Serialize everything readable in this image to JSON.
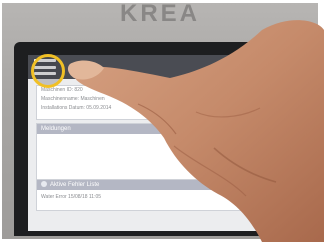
{
  "brand": {
    "text": "KREA"
  },
  "screen": {
    "machine_info": {
      "title": "",
      "lines": [
        "Maschinen ID: 820",
        "Maschinenname: Maschinen",
        "Installations Datum: 05.09.2014"
      ]
    },
    "messages": {
      "title": "Meldungen"
    },
    "active_errors": {
      "title": "Aktive Fehler Liste",
      "entry": "Water Error    15/08/18 11:05"
    }
  },
  "highlight": {
    "ring_color": "#f1c025"
  },
  "icons": {
    "menu": "hamburger-menu-icon"
  }
}
